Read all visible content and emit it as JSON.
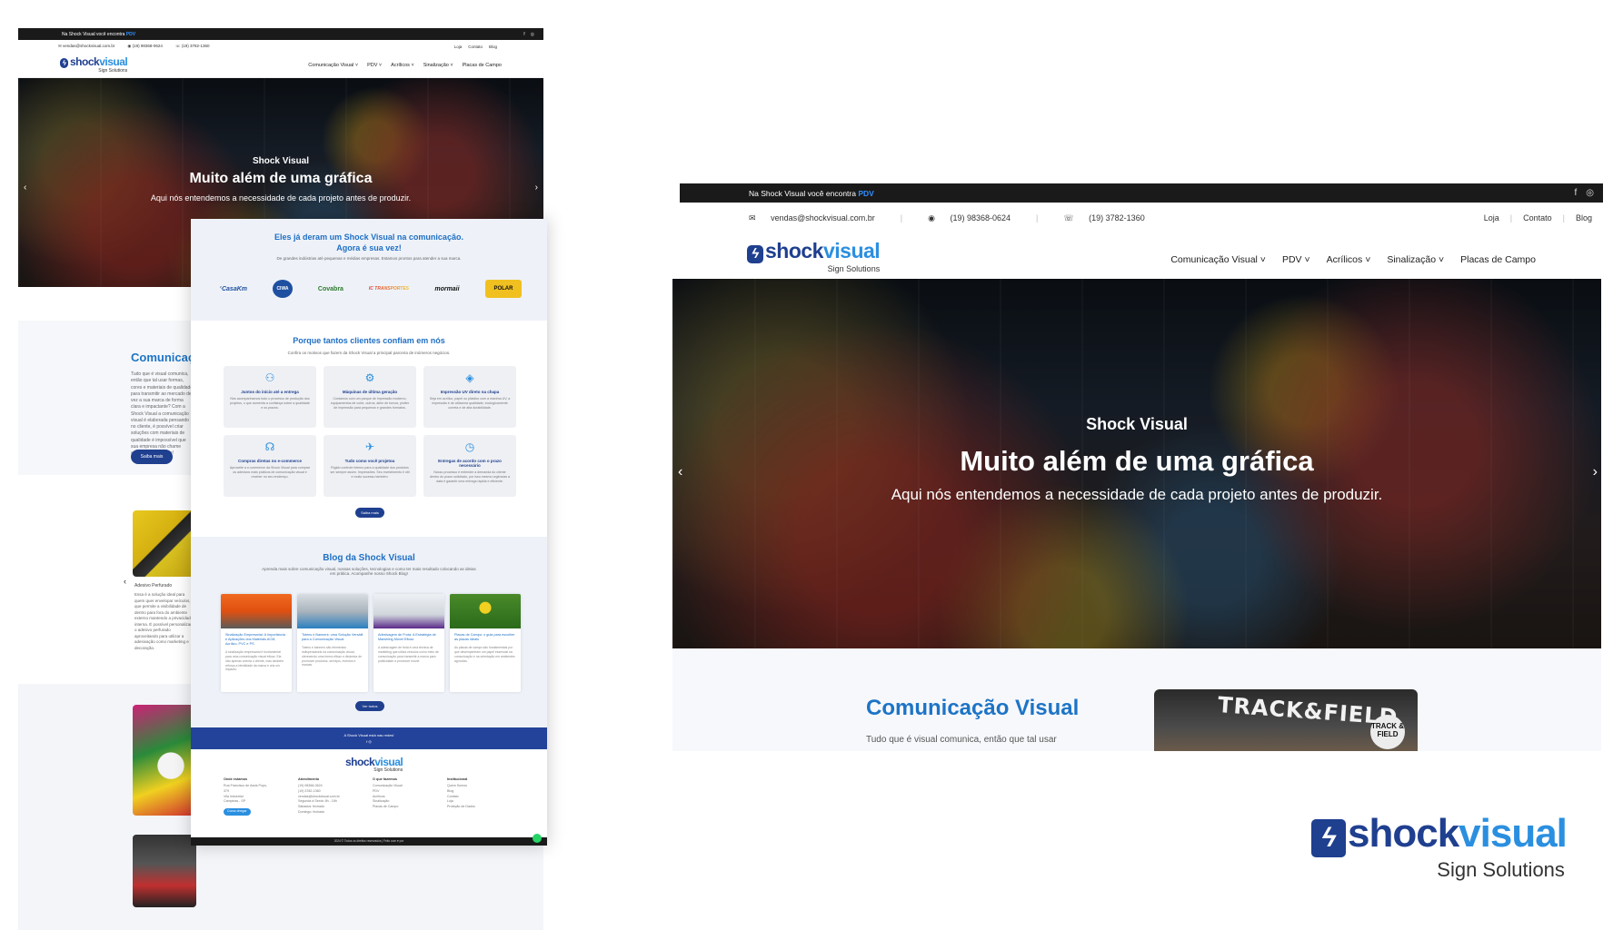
{
  "site": {
    "topbar_prefix": "Na Shock Visual você encontra",
    "topbar_highlight": "PDV",
    "social": [
      "f",
      "◎"
    ],
    "email": "vendas@shockvisual.com.br",
    "whatsapp": "(19) 98368-0624",
    "phone": "(19) 3782-1360",
    "utility_links": [
      "Loja",
      "Contato",
      "Blog"
    ],
    "logo_word_a": "shock",
    "logo_word_b": "visual",
    "logo_tagline": "Sign Solutions",
    "nav": [
      "Comunicação Visual",
      "PDV",
      "Acrílicos",
      "Sinalização",
      "Placas de Campo"
    ]
  },
  "hero": {
    "kicker": "Shock Visual",
    "title": "Muito além de uma gráfica",
    "subtitle": "Aqui nós entendemos a necessidade de cada projeto antes de produzir."
  },
  "left_page": {
    "section_title": "Comunicaç",
    "section_text": "Tudo que é visual comunica, então que tal usar formas, cores e materiais de qualidade para transmitir ao mercado de vez a sua marca de forma clara e impactante? Com a Shock Visual a comunicação visual é elaborada pensando no cliente, é possível criar soluções com materiais de qualidade é impossível que sua empresa não chame atenção do mercado!",
    "section_button": "Saiba mais",
    "caption_title": "Adesivo Perfurado",
    "caption_text": "Essa é a solução ideal para quem quer envelopar veículos, que permite a visibilidade de dentro para fora do ambiente externo mantendo a privacidade interna. É possível personalizar o adesivo perfurado aproveitando para utilizar a adesivação como marketing e decoração.",
    "slider_arrow": "‹"
  },
  "overlay": {
    "clients_title_1": "Eles já deram um Shock Visual na comunicação.",
    "clients_title_2": "Agora é sua vez!",
    "clients_sub": "De grandes indústrias até pequenas e médias empresas. Estamos prontos para atender a sua marca.",
    "client_logos": [
      "CasaKm",
      "CIWA",
      "Covabra",
      "IC TRANSPORTES",
      "mormaii",
      "POLAR"
    ],
    "why_title": "Porque tantos clientes confiam em nós",
    "why_sub": "Confira os motivos que fazem da Shock Visual a principal parceira de inúmeros negócios.",
    "cards": [
      {
        "icon": "⚇",
        "title": "Juntos do início até a entrega",
        "text": "Nós acompanhamos todo o processo de produção dos projetos, o que aumenta a confiança sobre a qualidade e os prazos."
      },
      {
        "icon": "⚙",
        "title": "Máquinas de última geração",
        "text": "Contamos com um parque de impressão moderno, equipamentos de corte, outros, além de tornos, plotter de impressão para pequenos e grandes formatos."
      },
      {
        "icon": "◈",
        "title": "Impressão UV direto na chapa",
        "text": "Seja em acrílico, papel ou plástico com a máxima UV, a impressão é de altíssima qualidade, ecologicamente correta e de alta durabilidade."
      },
      {
        "icon": "☊",
        "title": "Compras diretas no e-commerce",
        "text": "Aproveite a e-commerce da Shock Visual para comprar os adesivos mais práticos de comunicação visual e receber no seu endereço."
      },
      {
        "icon": "✈",
        "title": "Tudo como você projetou",
        "text": "Rígido controle interno para a qualidade dos produtos ser sempre assim. Impressões. Seu investimento é útil e muito sucesso também."
      },
      {
        "icon": "◷",
        "title": "Entregas de acordo com o prazo necessário",
        "text": "Nosso processo é entender a demanda do cliente dentro do prazo solicitado, por isso mesmo urgências a data é garantir uma entrega rápida e eficiente."
      }
    ],
    "why_button": "Saiba mais",
    "blog_title": "Blog da Shock Visual",
    "blog_sub": "Aprenda mais sobre comunicação visual, nossas soluções, tecnologias e como ter mais resultado colocando as ideias em prática. Acompanhe nosso Shock Blog!",
    "posts": [
      {
        "title": "Sinalização Empresarial: A Importância e Aplicações dos Materiais ACM, Acrílico, PVC e PS",
        "text": "A sinalização empresarial é fundamental para uma comunicação visual eficaz. Ela não apenas orienta o cliente, mas também reforça a identidade da marca e cria um impacto."
      },
      {
        "title": "Totens e Banners: uma Solução Versátil para a Comunicação Visual",
        "text": "Totens e banners são elementos indispensáveis na comunicação visual, oferecendo uma forma eficaz e dinâmica de promover produtos, serviços, eventos e marcas."
      },
      {
        "title": "Adesivagem de Frota: A Estratégia de Marketing Móvel Eficaz",
        "text": "A adesivagem de frota é uma técnica de marketing que utiliza veículos como meio de comunicação para transmitir a marca para publicidade a promover móvel."
      },
      {
        "title": "Placas de Campo: o guia para escolher as placas ideais",
        "text": "As placas de campo são fundamentais por que desempenham um papel essencial na comunicação e na orientação em ambientes agrícolas."
      }
    ],
    "blog_button": "Ver todos",
    "band_text": "A Shock Visual está nas redes!",
    "footer_cols": [
      {
        "head": "Onde estamos",
        "lines": [
          "Rua Francisco de Assis Pupo, 379",
          "Vila Industrial",
          "Campinas - SP"
        ],
        "btn": "Como chegar"
      },
      {
        "head": "Atendimento",
        "lines": [
          "(19) 98368-0624",
          "(19) 3782-1360",
          "vendas@shockvisual.com.br",
          "Segunda à Sexta: 8h - 18h",
          "Sábados: fechado",
          "Domingo: fechado"
        ]
      },
      {
        "head": "O que fazemos",
        "lines": [
          "Comunicação Visual",
          "PDV",
          "Acrílicos",
          "Sinalização",
          "Placas de Campo"
        ]
      },
      {
        "head": "Institucional",
        "lines": [
          "Quem Somos",
          "Blog",
          "Contato",
          "Loja",
          "Proteção de Dados"
        ]
      }
    ],
    "copyright": "2024 © Todos os direitos reservados | Feito com ♥ por"
  },
  "right_page": {
    "section_title": "Comunicação Visual",
    "section_text": "Tudo que é visual comunica, então que tal usar",
    "image_sign": "TRACK&FIELD",
    "image_badge": "TRACK & FIELD"
  },
  "brand_logo": {
    "word_a": "shock",
    "word_b": "visual",
    "tagline": "Sign Solutions"
  },
  "colors": {
    "brand_dark": "#1f3f8f",
    "brand_light": "#2b8fe0",
    "heading": "#1d74c6",
    "topbar": "#1a1a1a"
  }
}
